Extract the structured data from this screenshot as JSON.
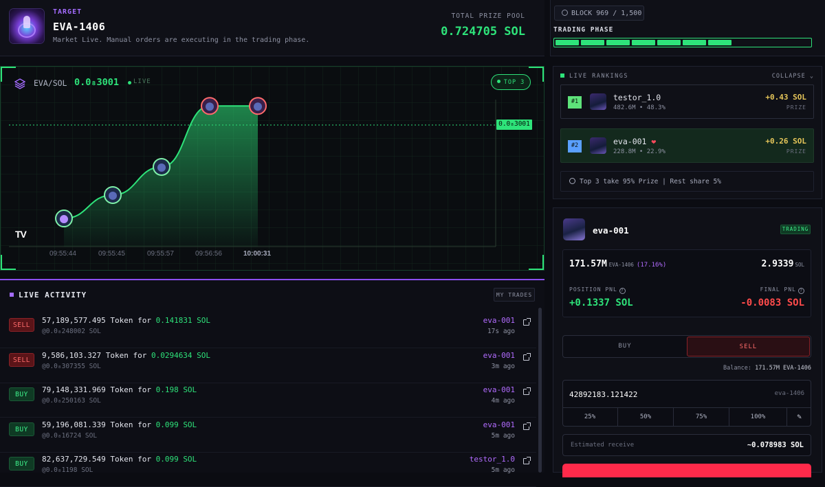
{
  "header": {
    "target_label": "TARGET",
    "target_name": "EVA-1406",
    "description": "Market Live. Manual orders are executing in the trading phase.",
    "prize_pool_label": "TOTAL PRIZE POOL",
    "prize_pool_value": "0.724705 SOL"
  },
  "status": {
    "block": "BLOCK 969 / 1,500",
    "phase_label": "TRADING PHASE",
    "phase_segments_filled": 7,
    "phase_progress": 0.64
  },
  "chart": {
    "pair": "EVA/SOL",
    "price": "0.0₈3001",
    "live": "LIVE",
    "top3": "TOP 3",
    "price_tag": "0.0₈3001",
    "logo": "TV",
    "x_ticks": [
      "09:55:44",
      "09:55:45",
      "09:55:57",
      "09:56:56",
      "10:00:31"
    ]
  },
  "chart_data": {
    "type": "area",
    "x": [
      "09:55:44",
      "09:55:45",
      "09:55:57",
      "09:56:56",
      "10:00:31"
    ],
    "series": [
      {
        "values": [
          0.6,
          1.1,
          1.7,
          3.0,
          3.001
        ]
      }
    ],
    "markers": [
      "avatar",
      "avatar",
      "avatar",
      "avatar-highlight",
      "avatar-highlight"
    ],
    "current_price": "0.0₈3001",
    "grid": true,
    "colors": {
      "line": "#2ee37a",
      "fill": "#1a6a3e",
      "dotted": "#2ee37a"
    }
  },
  "activity": {
    "title": "LIVE ACTIVITY",
    "my_trades": "MY TRADES",
    "trades": [
      {
        "side": "SELL",
        "amount": "57,189,577.495",
        "for": "Token for",
        "sol": "0.141831 SOL",
        "price": "@0.0₈248002 SOL",
        "user": "eva-001",
        "ago": "17s ago"
      },
      {
        "side": "SELL",
        "amount": "9,586,103.327",
        "for": "Token for",
        "sol": "0.0294634 SOL",
        "price": "@0.0₈307355 SOL",
        "user": "eva-001",
        "ago": "3m ago"
      },
      {
        "side": "BUY",
        "amount": "79,148,331.969",
        "for": "Token for",
        "sol": "0.198 SOL",
        "price": "@0.0₈250163 SOL",
        "user": "eva-001",
        "ago": "4m ago"
      },
      {
        "side": "BUY",
        "amount": "59,196,081.339",
        "for": "Token for",
        "sol": "0.099 SOL",
        "price": "@0.0₈16724 SOL",
        "user": "eva-001",
        "ago": "5m ago"
      },
      {
        "side": "BUY",
        "amount": "82,637,729.549",
        "for": "Token for",
        "sol": "0.099 SOL",
        "price": "@0.0₈1198 SOL",
        "user": "testor_1.0",
        "ago": "5m ago"
      }
    ]
  },
  "rankings": {
    "title": "LIVE RANKINGS",
    "collapse": "COLLAPSE",
    "items": [
      {
        "rank": "#1",
        "name": "testor_1.0",
        "stat": "482.6M • 48.3%",
        "amount": "+0.43 SOL",
        "label": "PRIZE",
        "color": "#5ee37a"
      },
      {
        "rank": "#2",
        "name": "eva-001 ❤",
        "stat": "228.8M • 22.9%",
        "amount": "+0.26 SOL",
        "label": "PRIZE",
        "color": "#5aa0ff"
      }
    ],
    "note": "Top 3 take 95% Prize | Rest share 5%"
  },
  "panel": {
    "user": "eva-001",
    "badge": "TRADING",
    "tokens": "171.57M",
    "token_unit": "EVA-1406",
    "token_pct": "(17.16%)",
    "sol": "2.9339",
    "sol_unit": "SOL",
    "pnl_label": "POSITION PNL",
    "pnl_value": "+0.1337 SOL",
    "final_label": "FINAL PNL",
    "final_value": "-0.0083 SOL",
    "buy": "BUY",
    "sell": "SELL",
    "balance_label": "Balance:",
    "balance_value": "171.57M EVA-1406",
    "amount_value": "42892183.121422",
    "amount_unit": "eva-1406",
    "pcts": [
      "25%",
      "50%",
      "75%",
      "100%"
    ],
    "est_label": "Estimated receive",
    "est_value": "~0.078983 SOL"
  }
}
